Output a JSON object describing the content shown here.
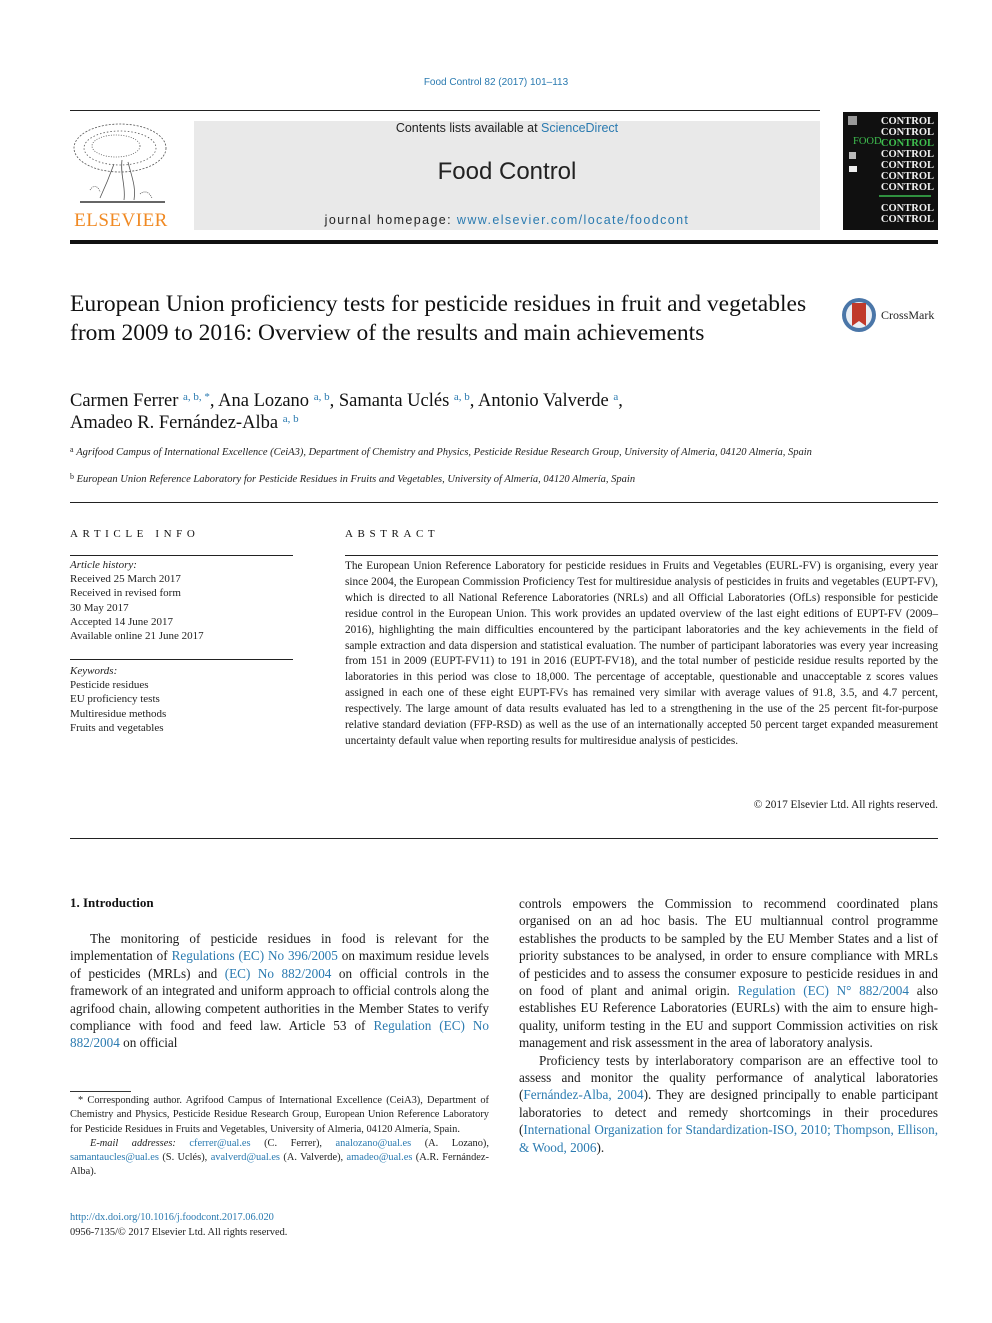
{
  "header": {
    "journal_ref": "Food Control 82 (2017) 101–113",
    "contents_prefix": "Contents lists available at ",
    "contents_link": "ScienceDirect",
    "journal_title": "Food Control",
    "homepage_prefix": "journal homepage: ",
    "homepage_link": "www.elsevier.com/locate/foodcont",
    "publisher_logo_text": "ELSEVIER",
    "cover": {
      "word": "CONTROL",
      "food_word": "FOOD",
      "colors": {
        "background": "#101010",
        "accent": "#3fbf4f",
        "text": "#f2f2f2"
      }
    }
  },
  "colors": {
    "link": "#2a7ab0",
    "elsevier_orange": "#f08a24",
    "masthead_bg": "#e9e9e9"
  },
  "crossmark": {
    "label": "CrossMark"
  },
  "article": {
    "title": "European Union proficiency tests for pesticide residues in fruit and vegetables from 2009 to 2016: Overview of the results and main achievements",
    "authors": [
      {
        "name": "Carmen Ferrer",
        "affil": "a, b, *"
      },
      {
        "name": "Ana Lozano",
        "affil": "a, b"
      },
      {
        "name": "Samanta Uclés",
        "affil": "a, b"
      },
      {
        "name": "Antonio Valverde",
        "affil": "a"
      },
      {
        "name": "Amadeo R. Fernández-Alba",
        "affil": "a, b"
      }
    ],
    "affiliations": [
      {
        "mark": "a",
        "text": "Agrifood Campus of International Excellence (CeiA3), Department of Chemistry and Physics, Pesticide Residue Research Group, University of Almeria, 04120 Almería, Spain"
      },
      {
        "mark": "b",
        "text": "European Union Reference Laboratory for Pesticide Residues in Fruits and Vegetables, University of Almería, 04120 Almería, Spain"
      }
    ]
  },
  "article_info": {
    "heading": "ARTICLE INFO",
    "history_label": "Article history:",
    "history": [
      "Received 25 March 2017",
      "Received in revised form",
      "30 May 2017",
      "Accepted 14 June 2017",
      "Available online 21 June 2017"
    ],
    "keywords_label": "Keywords:",
    "keywords": [
      "Pesticide residues",
      "EU proficiency tests",
      "Multiresidue methods",
      "Fruits and vegetables"
    ]
  },
  "abstract": {
    "heading": "ABSTRACT",
    "text": "The European Union Reference Laboratory for pesticide residues in Fruits and Vegetables (EURL-FV) is organising, every year since 2004, the European Commission Proficiency Test for multiresidue analysis of pesticides in fruits and vegetables (EUPT-FV), which is directed to all National Reference Laboratories (NRLs) and all Official Laboratories (OfLs) responsible for pesticide residue control in the European Union. This work provides an updated overview of the last eight editions of EUPT-FV (2009–2016), highlighting the main difficulties encountered by the participant laboratories and the key achievements in the field of sample extraction and data dispersion and statistical evaluation. The number of participant laboratories was every year increasing from 151 in 2009 (EUPT-FV11) to 191 in 2016 (EUPT-FV18), and the total number of pesticide residue results reported by the laboratories in this period was close to 18,000. The percentage of acceptable, questionable and unacceptable z scores values assigned in each one of these eight EUPT-FVs has remained very similar with average values of 91.8, 3.5, and 4.7 percent, respectively. The large amount of data results evaluated has led to a strengthening in the use of the 25 percent fit-for-purpose relative standard deviation (FFP-RSD) as well as the use of an internationally accepted 50 percent target expanded measurement uncertainty default value when reporting results for multiresidue analysis of pesticides.",
    "copyright": "© 2017 Elsevier Ltd. All rights reserved."
  },
  "body": {
    "section_heading": "1.  Introduction",
    "left_para": {
      "t1": "The monitoring of pesticide residues in food is relevant for the implementation of ",
      "l1": "Regulations (EC) No 396/2005",
      "t2": " on maximum residue levels of pesticides (MRLs) and ",
      "l2": "(EC) No 882/2004",
      "t3": " on official controls in the framework of an integrated and uniform approach to official controls along the agrifood chain, allowing competent authorities in the Member States to verify compliance with food and feed law. Article 53 of ",
      "l3": "Regulation (EC) No 882/2004",
      "t4": " on official"
    },
    "right_para1": {
      "t1": "controls empowers the Commission to recommend coordinated plans organised on an ad hoc basis. The EU multiannual control programme establishes the products to be sampled by the EU Member States and a list of priority substances to be analysed, in order to ensure compliance with MRLs of pesticides and to assess the consumer exposure to pesticide residues in and on food of plant and animal origin. ",
      "l1": "Regulation (EC) N° 882/2004",
      "t2": " also establishes EU Reference Laboratories (EURLs) with the aim to ensure high-quality, uniform testing in the EU and support Commission activities on risk management and risk assessment in the area of laboratory analysis."
    },
    "right_para2": {
      "t1": "Proficiency tests by interlaboratory comparison are an effective tool to assess and monitor the quality performance of analytical laboratories (",
      "l1": "Fernández-Alba, 2004",
      "t2": "). They are designed principally to enable participant laboratories to detect and remedy shortcomings in their procedures (",
      "l2": "International Organization for Standardization-ISO, 2010; Thompson, Ellison, & Wood, 2006",
      "t3": ")."
    }
  },
  "footnotes": {
    "corresponding": "* Corresponding author. Agrifood Campus of International Excellence (CeiA3), Department of Chemistry and Physics, Pesticide Residue Research Group, European Union Reference Laboratory for Pesticide Residues in Fruits and Vegetables, University of Almeria, 04120 Almería, Spain.",
    "email_label": "E-mail addresses:",
    "emails": [
      {
        "email": "cferrer@ual.es",
        "name": "(C. Ferrer),"
      },
      {
        "email": "analozano@ual.es",
        "name": "(A. Lozano),"
      },
      {
        "email": "samantaucles@ual.es",
        "name": "(S. Uclés),"
      },
      {
        "email": "avalverd@ual.es",
        "name": "(A. Valverde),"
      },
      {
        "email": "amadeo@ual.es",
        "name": "(A.R. Fernández-Alba)."
      }
    ],
    "doi": "http://dx.doi.org/10.1016/j.foodcont.2017.06.020",
    "issn": "0956-7135/© 2017 Elsevier Ltd. All rights reserved."
  }
}
